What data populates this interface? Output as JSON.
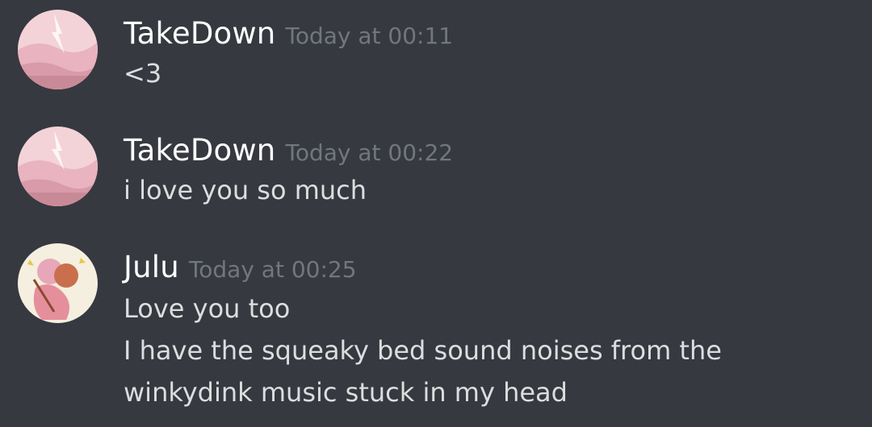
{
  "messages": [
    {
      "author": "TakeDown",
      "timestamp": "Today at 00:11",
      "avatar": "takedown-avatar",
      "lines": [
        "<3"
      ]
    },
    {
      "author": "TakeDown",
      "timestamp": "Today at 00:22",
      "avatar": "takedown-avatar",
      "lines": [
        "i love you so much"
      ]
    },
    {
      "author": "Julu",
      "timestamp": "Today at 00:25",
      "avatar": "julu-avatar",
      "lines": [
        "Love you too",
        "I have the squeaky bed sound noises from the",
        "winkydink music stuck in my head"
      ]
    }
  ],
  "colors": {
    "background": "#36393f",
    "username": "#ffffff",
    "timestamp": "#72767d",
    "message_text": "#dcddde"
  }
}
